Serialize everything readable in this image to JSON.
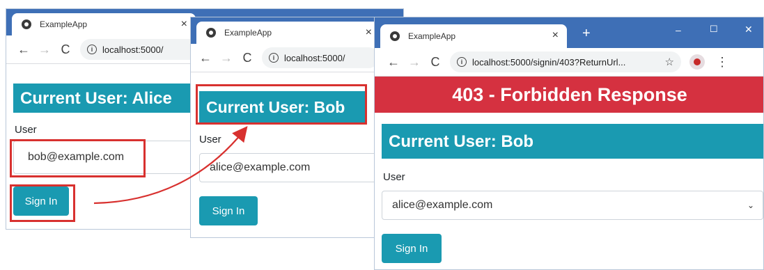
{
  "colors": {
    "highlight": "#d8312f",
    "banner": "#1a9ab1",
    "forbidden": "#d53140",
    "tabbar": "#3e6fb6"
  },
  "window1": {
    "tab_title": "ExampleApp",
    "url": "localhost:5000/",
    "heading": "Current User: Alice",
    "user_label": "User",
    "user_value": "bob@example.com",
    "button": "Sign In"
  },
  "window2": {
    "tab_title": "ExampleApp",
    "url": "localhost:5000/",
    "heading": "Current User: Bob",
    "user_label": "User",
    "user_value": "alice@example.com",
    "button": "Sign In"
  },
  "window3": {
    "tab_title": "ExampleApp",
    "new_tab": "+",
    "controls": {
      "minimize": "–",
      "maximize": "☐",
      "close": "✕"
    },
    "url": "localhost:5000/signin/403?ReturnUrl...",
    "forbidden": "403 - Forbidden Response",
    "heading": "Current User: Bob",
    "user_label": "User",
    "user_value": "alice@example.com",
    "button": "Sign In"
  },
  "icons": {
    "back": "back-arrow-icon",
    "forward": "forward-arrow-icon",
    "reload": "reload-icon",
    "info": "info-icon",
    "star": "star-icon",
    "profile": "profile-icon",
    "menu": "kebab-menu-icon"
  }
}
